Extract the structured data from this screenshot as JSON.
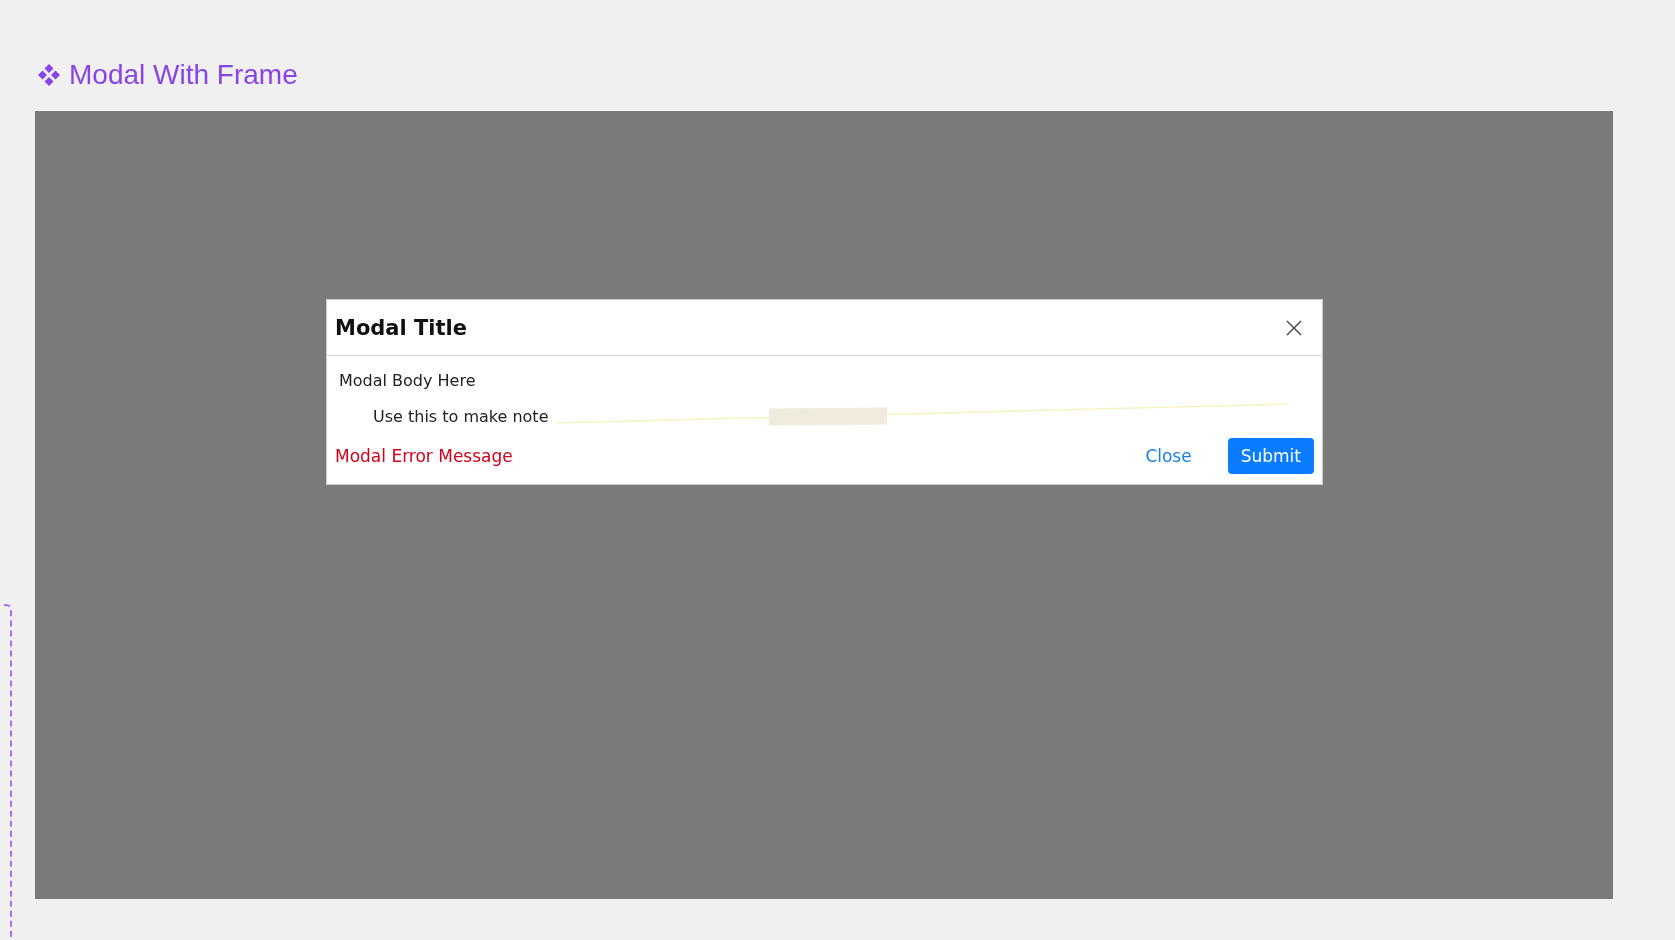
{
  "frame_label": {
    "title": "Modal With Frame"
  },
  "modal": {
    "title": "Modal Title",
    "body": "Modal Body Here",
    "note": "Use this to make note",
    "error_message": "Modal Error Message",
    "buttons": [
      {
        "label": "Close",
        "kind": "link"
      },
      {
        "label": "Submit",
        "kind": "primary"
      }
    ]
  }
}
